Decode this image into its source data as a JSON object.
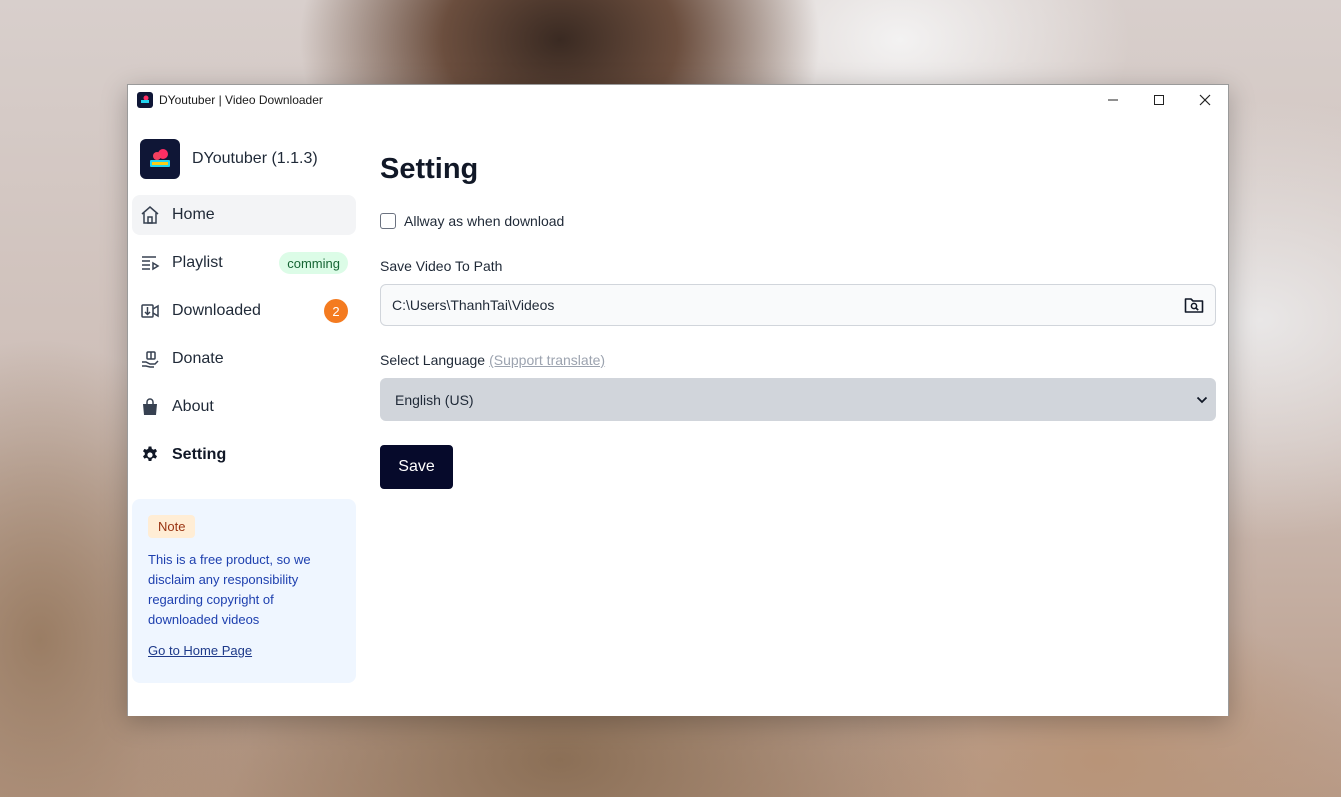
{
  "window": {
    "title": "DYoutuber | Video Downloader"
  },
  "sidebar": {
    "brand_name": "DYoutuber (1.1.3)",
    "items": [
      {
        "label": "Home",
        "icon": "home-icon"
      },
      {
        "label": "Playlist",
        "icon": "playlist-icon",
        "tag": "comming"
      },
      {
        "label": "Downloaded",
        "icon": "download-icon",
        "badge": "2"
      },
      {
        "label": "Donate",
        "icon": "donate-icon"
      },
      {
        "label": "About",
        "icon": "bag-icon"
      },
      {
        "label": "Setting",
        "icon": "gear-icon"
      }
    ],
    "note": {
      "badge": "Note",
      "text": "This is a free product, so we disclaim any responsibility regarding copyright of downloaded videos",
      "link": "Go to Home Page"
    }
  },
  "settings": {
    "title": "Setting",
    "checkbox_label": "Allway as when download",
    "checkbox_checked": false,
    "path_label": "Save Video To Path",
    "path_value": "C:\\Users\\ThanhTai\\Videos",
    "language_label": "Select Language",
    "language_link": "(Support translate)",
    "language_value": "English (US)",
    "save_label": "Save"
  },
  "colors": {
    "brand_dark": "#060a2b",
    "badge_orange": "#f47b20",
    "tag_green_bg": "#dcfce7",
    "note_bg": "#eff6ff"
  }
}
